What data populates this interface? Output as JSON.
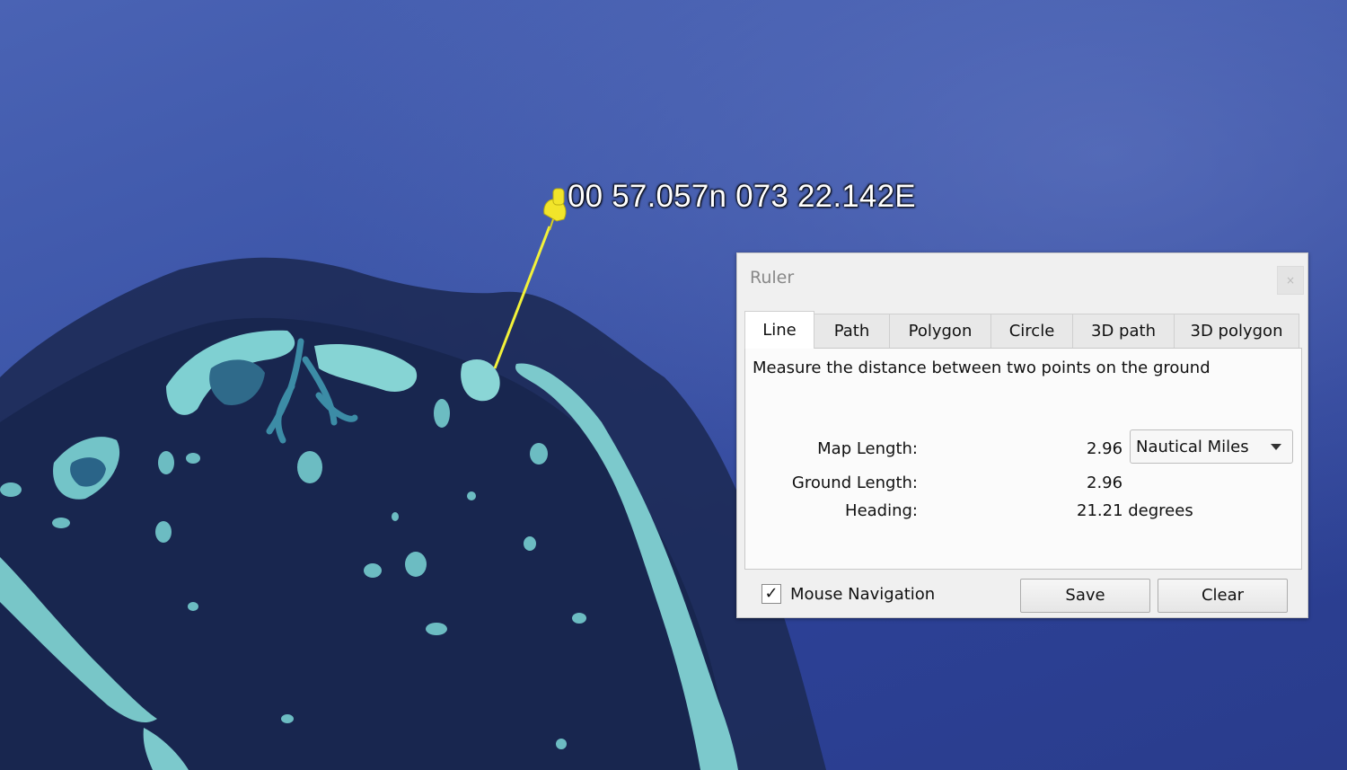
{
  "map": {
    "placemark_label": "00 57.057n 073 22.142E",
    "pin_color": "#f2e52a",
    "line_color": "#f2f23a"
  },
  "ruler": {
    "title": "Ruler",
    "tabs": [
      {
        "label": "Line",
        "active": true
      },
      {
        "label": "Path",
        "active": false
      },
      {
        "label": "Polygon",
        "active": false
      },
      {
        "label": "Circle",
        "active": false
      },
      {
        "label": "3D path",
        "active": false
      },
      {
        "label": "3D polygon",
        "active": false
      }
    ],
    "description": "Measure the distance between two points on the ground",
    "map_length_label": "Map Length:",
    "map_length_value": "2.96",
    "units_selected": "Nautical Miles",
    "ground_length_label": "Ground Length:",
    "ground_length_value": "2.96",
    "heading_label": "Heading:",
    "heading_value": "21.21 degrees",
    "mouse_navigation_label": "Mouse Navigation",
    "mouse_navigation_checked": true,
    "save_label": "Save",
    "clear_label": "Clear"
  }
}
